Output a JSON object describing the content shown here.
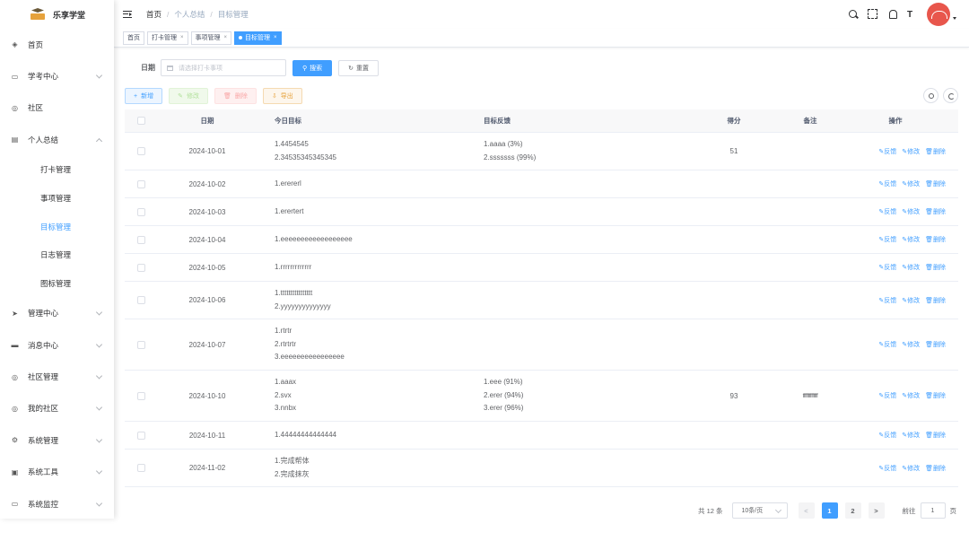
{
  "app": {
    "logo_text": "乐享学堂"
  },
  "sidebar": {
    "items": [
      {
        "label": "首页",
        "icon": "dashboard-icon",
        "chev": "none"
      },
      {
        "label": "学考中心",
        "icon": "monitor-icon",
        "chev": "down"
      },
      {
        "label": "社区",
        "icon": "community-icon",
        "chev": "none"
      },
      {
        "label": "个人总结",
        "icon": "document-icon",
        "chev": "up"
      },
      {
        "label": "管理中心",
        "icon": "send-icon",
        "chev": "down"
      },
      {
        "label": "消息中心",
        "icon": "message-icon",
        "chev": "down"
      },
      {
        "label": "社区管理",
        "icon": "community-manage-icon",
        "chev": "down"
      },
      {
        "label": "我的社区",
        "icon": "my-community-icon",
        "chev": "down"
      },
      {
        "label": "系统管理",
        "icon": "settings-icon",
        "chev": "down"
      },
      {
        "label": "系统工具",
        "icon": "tools-icon",
        "chev": "down"
      },
      {
        "label": "系统监控",
        "icon": "monitor-system-icon",
        "chev": "down"
      }
    ],
    "sub_items": [
      {
        "label": "打卡管理"
      },
      {
        "label": "事项管理"
      },
      {
        "label": "目标管理"
      },
      {
        "label": "日志管理"
      },
      {
        "label": "图标管理"
      }
    ]
  },
  "header": {
    "breadcrumb": [
      "首页",
      "个人总结",
      "目标管理"
    ],
    "size_icon_text": "T"
  },
  "tags": [
    {
      "label": "首页",
      "active": false,
      "closable": false
    },
    {
      "label": "打卡管理",
      "active": false,
      "closable": true
    },
    {
      "label": "事项管理",
      "active": false,
      "closable": true
    },
    {
      "label": "目标管理",
      "active": true,
      "closable": true
    }
  ],
  "filter": {
    "date_label": "日期",
    "date_placeholder": "请选择打卡事项",
    "search_label": "搜索",
    "reset_label": "重置"
  },
  "actions": {
    "add": "新增",
    "edit": "修改",
    "delete": "删除",
    "export": "导出"
  },
  "table": {
    "headers": [
      "日期",
      "今日目标",
      "目标反馈",
      "得分",
      "备注",
      "操作"
    ],
    "op_labels": [
      "反馈",
      "修改",
      "删除"
    ],
    "rows": [
      {
        "date": "2024-10-01",
        "goals": [
          "1.4454545",
          "2.34535345345345"
        ],
        "feedback": [
          "1.aaaa (3%)",
          "2.sssssss (99%)"
        ],
        "score": "51",
        "note": ""
      },
      {
        "date": "2024-10-02",
        "goals": [
          "1.erererl"
        ],
        "feedback": [],
        "score": "",
        "note": ""
      },
      {
        "date": "2024-10-03",
        "goals": [
          "1.erertert"
        ],
        "feedback": [],
        "score": "",
        "note": ""
      },
      {
        "date": "2024-10-04",
        "goals": [
          "1.eeeeeeeeeeeeeeeeee"
        ],
        "feedback": [],
        "score": "",
        "note": ""
      },
      {
        "date": "2024-10-05",
        "goals": [
          "1.rrrrrrrrrrrrr"
        ],
        "feedback": [],
        "score": "",
        "note": ""
      },
      {
        "date": "2024-10-06",
        "goals": [
          "1.tttttttttttttttt",
          "2.yyyyyyyyyyyyyy"
        ],
        "feedback": [],
        "score": "",
        "note": ""
      },
      {
        "date": "2024-10-07",
        "goals": [
          "1.rtrtr",
          "2.rtrtrtr",
          "3.eeeeeeeeeeeeeeee"
        ],
        "feedback": [],
        "score": "",
        "note": ""
      },
      {
        "date": "2024-10-10",
        "goals": [
          "1.aaax",
          "2.svx",
          "3.nnbx"
        ],
        "feedback": [
          "1.eee (91%)",
          "2.erer (94%)",
          "3.erer (96%)"
        ],
        "score": "93",
        "note": "ffffffffffffff"
      },
      {
        "date": "2024-10-11",
        "goals": [
          "1.44444444444444"
        ],
        "feedback": [],
        "score": "",
        "note": ""
      },
      {
        "date": "2024-11-02",
        "goals": [
          "1.完成帮体",
          "2.完成抹灰"
        ],
        "feedback": [],
        "score": "",
        "note": ""
      }
    ]
  },
  "pagination": {
    "total_text": "共 12 条",
    "page_size": "10条/页",
    "prev": "<",
    "pages": [
      "1",
      "2"
    ],
    "current_page": "1",
    "next": ">",
    "goto_label": "前往",
    "goto_value": "1",
    "page_suffix": "页"
  },
  "colors": {
    "primary": "#409eff",
    "avatar_bg": "#e8564c"
  }
}
